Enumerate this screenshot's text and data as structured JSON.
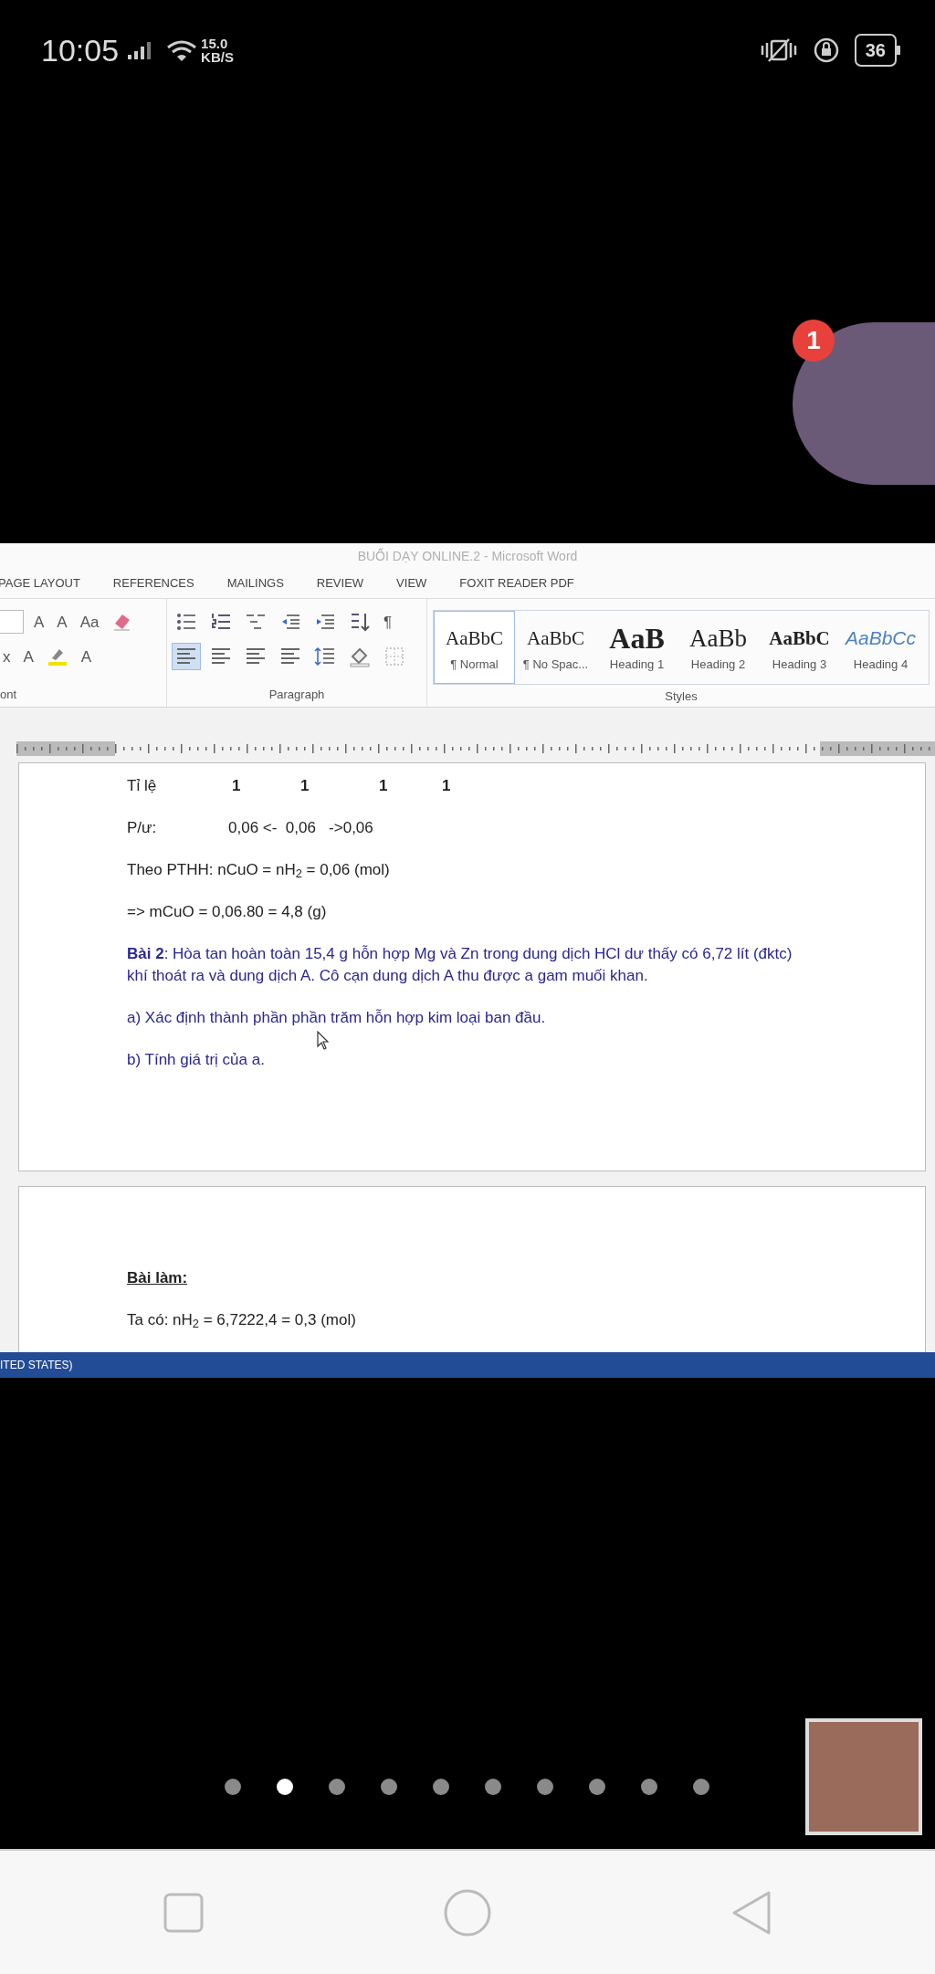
{
  "phone_status": {
    "time": "10:05",
    "speed_value": "15.0",
    "speed_unit": "KB/S",
    "battery": "36"
  },
  "call": {
    "badge": "1"
  },
  "word": {
    "title": "BUỔI DẠY ONLINE.2 - Microsoft Word",
    "tabs": [
      {
        "label": "PAGE LAYOUT",
        "selected": false
      },
      {
        "label": "REFERENCES",
        "selected": false
      },
      {
        "label": "MAILINGS",
        "selected": false
      },
      {
        "label": "REVIEW",
        "selected": false
      },
      {
        "label": "VIEW",
        "selected": false
      },
      {
        "label": "FOXIT READER PDF",
        "selected": false
      }
    ],
    "font_group": {
      "label": "ont",
      "row_1": [
        {
          "kind": "combo"
        },
        {
          "kind": "glyph",
          "label": "A"
        },
        {
          "kind": "glyph",
          "label": "A"
        },
        {
          "kind": "glyph",
          "label": "Aa"
        },
        {
          "kind": "eraser"
        }
      ],
      "row_2": [
        {
          "kind": "glyph",
          "label": "x"
        },
        {
          "kind": "glyph",
          "label": "A"
        },
        {
          "kind": "highlighter"
        },
        {
          "kind": "glyph",
          "label": "A"
        }
      ]
    },
    "paragraph_group": {
      "label": "Paragraph",
      "row_1": [
        {
          "kind": "bullets"
        },
        {
          "kind": "numbering"
        },
        {
          "kind": "multilevel"
        },
        {
          "kind": "outdent"
        },
        {
          "kind": "indent"
        },
        {
          "kind": "sort"
        },
        {
          "kind": "glyph",
          "label": "¶"
        }
      ],
      "row_2": [
        {
          "kind": "align",
          "selected": true
        },
        {
          "kind": "align",
          "selected": false
        },
        {
          "kind": "align",
          "selected": false
        },
        {
          "kind": "align",
          "selected": false
        },
        {
          "kind": "spacing"
        },
        {
          "kind": "shading"
        },
        {
          "kind": "borders"
        }
      ]
    },
    "styles_group": {
      "label": "Styles",
      "items": [
        {
          "preview": "AaBbC",
          "label": "¶ Normal",
          "selected": true
        },
        {
          "preview": "AaBbC",
          "label": "¶ No Spac...",
          "selected": false
        },
        {
          "preview": "AaB",
          "label": "Heading 1",
          "selected": false
        },
        {
          "preview": "AaBb",
          "label": "Heading 2",
          "selected": false
        },
        {
          "preview": "AaBbC",
          "label": "Heading 3",
          "selected": false
        },
        {
          "preview": "AaBbCc",
          "label": "Heading 4",
          "selected": false
        }
      ]
    },
    "page_1": [
      {
        "kind": "row",
        "cells": [
          "Tỉ lệ",
          "1",
          "1",
          "1",
          "1"
        ]
      },
      {
        "kind": "row",
        "cells": [
          "P/ư:",
          "0,06 <-  0,06   ->0,06"
        ]
      },
      {
        "kind": "text",
        "text": "Theo PTHH: nCuO = nH$_{2}$ = 0,06 (mol)"
      },
      {
        "kind": "text",
        "text": "=> mCuO = 0,06.80 = 4,8 (g)"
      },
      {
        "kind": "task",
        "text": "**Bài 2**: Hòa tan hoàn toàn 15,4 g hỗn hợp Mg và Zn trong dung dịch HCl dư thấy có 6,72 lít (đktc) khí thoát ra và dung dịch A. Cô cạn dung dịch A thu được a gam muối khan."
      },
      {
        "kind": "task",
        "text": "a) Xác định thành phần phần trăm hỗn hợp kim loại ban đầu."
      },
      {
        "kind": "task",
        "text": "b) Tính giá trị của a."
      }
    ],
    "page_2": [
      {
        "kind": "heading",
        "text": "Bài làm:"
      },
      {
        "kind": "text",
        "text": "Ta có: nH$_{2}$ = 6,7222,4 = 0,3 (mol)"
      }
    ],
    "status_text": "ITED STATES)"
  },
  "pager": [
    {
      "selected": false
    },
    {
      "selected": true
    },
    {
      "selected": false
    },
    {
      "selected": false
    },
    {
      "selected": false
    },
    {
      "selected": false
    },
    {
      "selected": false
    },
    {
      "selected": false
    },
    {
      "selected": false
    },
    {
      "selected": false
    }
  ]
}
